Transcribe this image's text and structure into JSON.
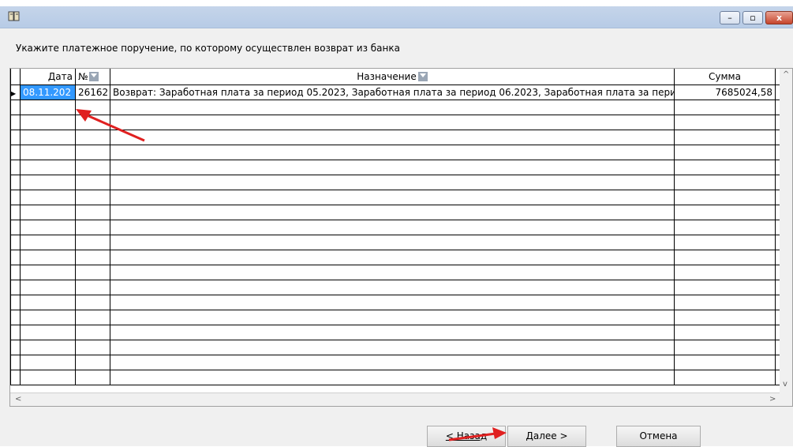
{
  "window": {
    "title": "",
    "controls": {
      "minimize": "–",
      "maximize": "▫",
      "close": "x"
    }
  },
  "instruction": "Укажите платежное поручение, по которому осуществлен  возврат из банка",
  "grid": {
    "columns": {
      "date": "Дата",
      "num": "№",
      "desc": "Назначение",
      "sum": "Сумма"
    },
    "rows": [
      {
        "date": "08.11.202",
        "num": "26162",
        "desc": "Возврат: Заработная плата за период 05.2023, Заработная плата за период 06.2023, Заработная плата за пери",
        "sum": "7685024,58"
      }
    ],
    "empty_rows": 19
  },
  "buttons": {
    "back": "< Назад",
    "next": "Далее >",
    "cancel": "Отмена"
  },
  "colors": {
    "selection": "#3399ff",
    "annotation_arrow": "#e02020"
  }
}
